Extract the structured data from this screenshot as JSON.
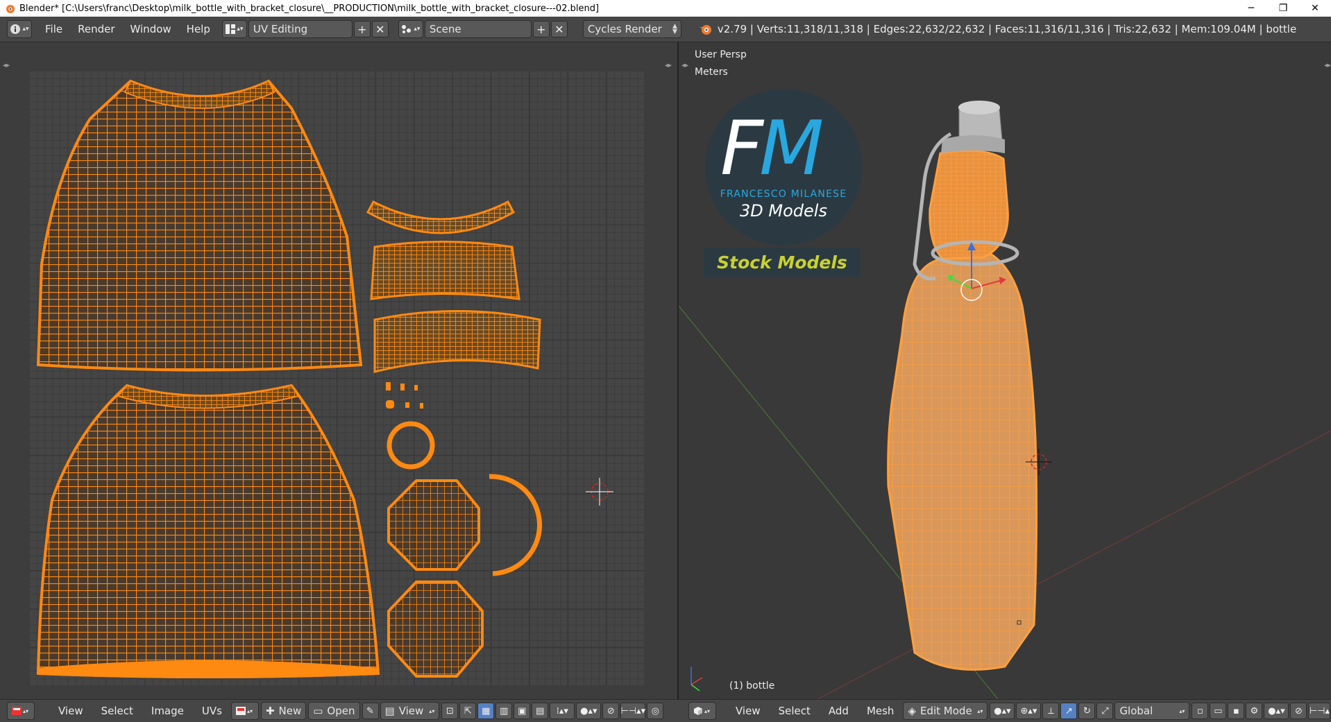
{
  "window": {
    "title": "Blender* [C:\\Users\\franc\\Desktop\\milk_bottle_with_bracket_closure\\__PRODUCTION\\milk_bottle_with_bracket_closure---02.blend]",
    "minimize": "─",
    "restore": "❐",
    "close": "✕"
  },
  "topbar": {
    "menus": [
      "File",
      "Render",
      "Window",
      "Help"
    ],
    "screen_layout": "UV Editing",
    "scene": "Scene",
    "render_engine": "Cycles Render",
    "stats": "v2.79 | Verts:11,318/11,318 | Edges:22,632/22,632 | Faces:11,316/11,316 | Tris:22,632 | Mem:109.04M | bottle"
  },
  "viewport": {
    "view_label": "User Persp",
    "units_label": "Meters",
    "object_label": "(1) bottle"
  },
  "watermark": {
    "letter_f": "F",
    "letter_m": "M",
    "name": "FRANCESCO MILANESE",
    "subtitle": "3D Models",
    "stock": "Stock Models"
  },
  "uv_bottombar": {
    "menus": [
      "View",
      "Select",
      "Image",
      "UVs"
    ],
    "new_label": "New",
    "open_label": "Open",
    "view_label": "View"
  },
  "view3d_bottombar": {
    "menus": [
      "View",
      "Select",
      "Add",
      "Mesh"
    ],
    "mode": "Edit Mode",
    "orientation": "Global"
  },
  "colors": {
    "uv_orange": "#ff8a12",
    "mesh_orange": "#ffa040",
    "selected_blue": "#5680c2"
  }
}
